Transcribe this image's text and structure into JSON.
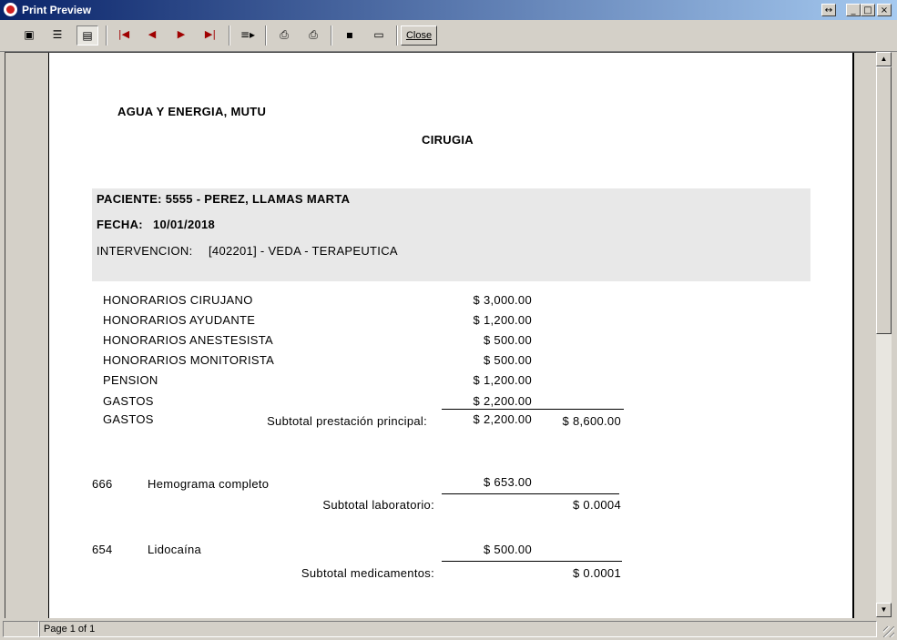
{
  "window": {
    "title": "Print Preview"
  },
  "toolbar": {
    "close_label": "Close"
  },
  "status": {
    "page_info": "Page 1 of 1"
  },
  "report": {
    "company": "AGUA Y ENERGIA, MUTU",
    "section": "CIRUGIA",
    "patient": "PACIENTE: 5555 - PEREZ, LLAMAS MARTA",
    "date_label": "FECHA:",
    "date_value": "10/01/2018",
    "intervention_label": "INTERVENCION:",
    "intervention_value": "[402201] - VEDA -  TERAPEUTICA",
    "items": [
      {
        "label": "HONORARIOS CIRUJANO",
        "amount": "$ 3,000.00"
      },
      {
        "label": "HONORARIOS AYUDANTE",
        "amount": "$ 1,200.00"
      },
      {
        "label": "HONORARIOS ANESTESISTA",
        "amount": "$ 500.00"
      },
      {
        "label": "HONORARIOS MONITORISTA",
        "amount": "$ 500.00"
      },
      {
        "label": "PENSION",
        "amount": "$ 1,200.00"
      },
      {
        "label": "GASTOS",
        "amount": "$ 2,200.00"
      },
      {
        "label": "GASTOS",
        "amount": "$ 2,200.00"
      }
    ],
    "subtotal_principal_label": "Subtotal prestación principal:",
    "subtotal_principal_value": "$ 8,600.00",
    "lab": {
      "code": "666",
      "name": "Hemograma completo",
      "amount": "$ 653.00",
      "subtotal_label": "Subtotal laboratorio:",
      "subtotal_value": "$ 0.0004"
    },
    "med": {
      "code": "654",
      "name": "Lidocaína",
      "amount": "$ 500.00",
      "subtotal_label": "Subtotal medicamentos:",
      "subtotal_value": "$ 0.0001"
    }
  }
}
